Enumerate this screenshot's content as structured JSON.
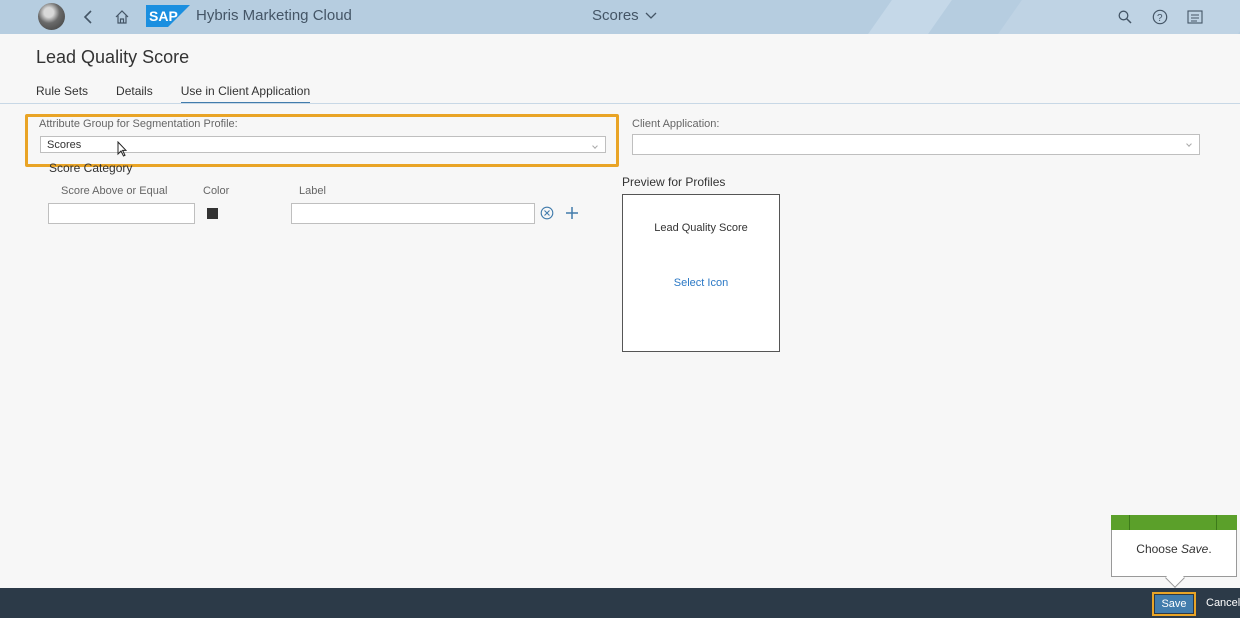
{
  "shell": {
    "app_title": "Hybris Marketing Cloud",
    "center_title": "Scores",
    "icons": [
      "avatar",
      "back-icon",
      "home-icon",
      "sap-logo",
      "search-icon",
      "help-icon",
      "menu-icon"
    ]
  },
  "header": {
    "title": "Lead Quality Score",
    "tabs": [
      {
        "label": "Rule Sets",
        "active": false
      },
      {
        "label": "Details",
        "active": false
      },
      {
        "label": "Use in Client Application",
        "active": true
      }
    ]
  },
  "form": {
    "attribute_group_label": "Attribute Group for Segmentation Profile:",
    "attribute_group_value": "Scores",
    "client_app_label": "Client Application:",
    "client_app_value": "",
    "score_category_title": "Score Category",
    "columns": {
      "score_above": "Score Above or Equal",
      "color": "Color",
      "label": "Label"
    },
    "row": {
      "score": "",
      "color": "#333333",
      "label": ""
    }
  },
  "preview": {
    "section_title": "Preview for Profiles",
    "card_title": "Lead Quality Score",
    "select_icon": "Select Icon"
  },
  "callout": {
    "prefix": "Choose ",
    "emphasis": "Save",
    "suffix": "."
  },
  "footer": {
    "save_label": "Save",
    "cancel_label": "Cancel"
  },
  "colors": {
    "shell_bg": "#b6cde0",
    "accent": "#427cac",
    "highlight": "#e9a426",
    "callout_bar": "#5ba02a",
    "footer_bg": "#2c3a48"
  }
}
